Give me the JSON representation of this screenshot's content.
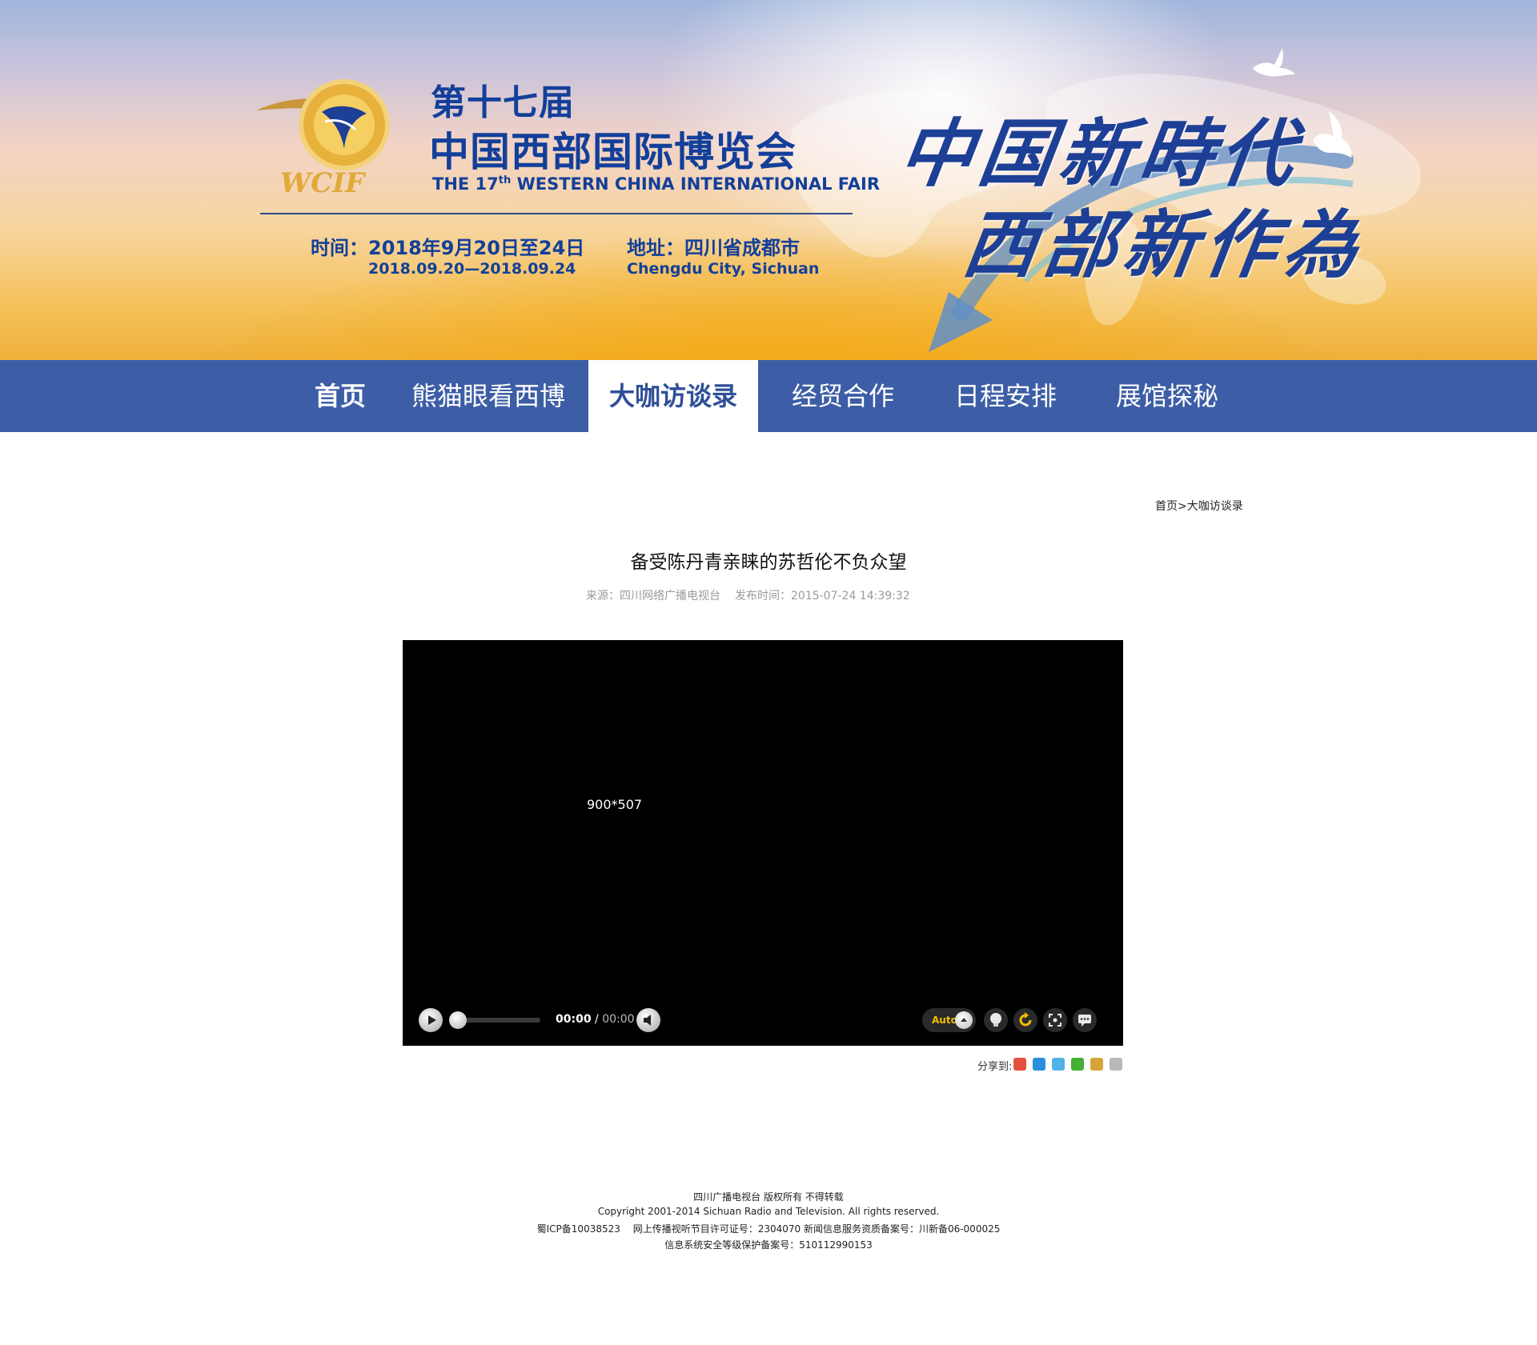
{
  "banner": {
    "title_cn_line1": "第十七届",
    "title_cn_line2": "中国西部国际博览会",
    "title_en_prefix": "THE 17",
    "title_en_sup": "th",
    "title_en_suffix": " WESTERN CHINA INTERNATIONAL FAIR",
    "date_cn": "时间：2018年9月20日至24日",
    "date_en": "2018.09.20—2018.09.24",
    "address_cn": "地址：四川省成都市",
    "address_en": "Chengdu City, Sichuan",
    "slogan_line1": "中国新時代",
    "slogan_line2": "西部新作為",
    "logo_ring_text": "WESTERN CHINA INTERNATIONAL FAIR",
    "logo_wordmark": "WCIF",
    "logo_top_text": "中国西部国际博览会",
    "colors": {
      "title": "#123f9a",
      "nav": "#3d5ea6"
    }
  },
  "nav": {
    "items": [
      {
        "label": "首页"
      },
      {
        "label": "熊猫眼看西博"
      },
      {
        "label": "大咖访谈录"
      },
      {
        "label": "经贸合作"
      },
      {
        "label": "日程安排"
      },
      {
        "label": "展馆探秘"
      }
    ],
    "active_index": 2
  },
  "breadcrumb": {
    "home": "首页",
    "separator": ">",
    "current": "大咖访谈录"
  },
  "article": {
    "title": "备受陈丹青亲睐的苏哲伦不负众望",
    "source": "来源：四川网络广播电视台",
    "published": "发布时间：2015-07-24 14:39:32"
  },
  "player": {
    "placeholder": "900*507",
    "current_time": "00:00",
    "time_separator": " / ",
    "total_time": "00:00",
    "quality": "Auto",
    "icons": [
      "play-icon",
      "volume-icon",
      "lightbulb-icon",
      "replay-icon",
      "fullscreen-icon",
      "comment-icon"
    ]
  },
  "share": {
    "label": "分享到:",
    "icons": [
      "weibo-icon",
      "qzone-icon",
      "tencent-weibo-icon",
      "wechat-icon",
      "renren-icon",
      "more-share-icon"
    ]
  },
  "footer": {
    "line1": "四川广播电视台 版权所有 不得转载",
    "line2": "Copyright 2001-2014 Sichuan Radio and Television. All rights reserved.",
    "line3": "蜀ICP备10038523　 网上传播视听节目许可证号：2304070 新闻信息服务资质备案号：川新备06-000025",
    "line4": "信息系统安全等级保护备案号：510112990153"
  }
}
